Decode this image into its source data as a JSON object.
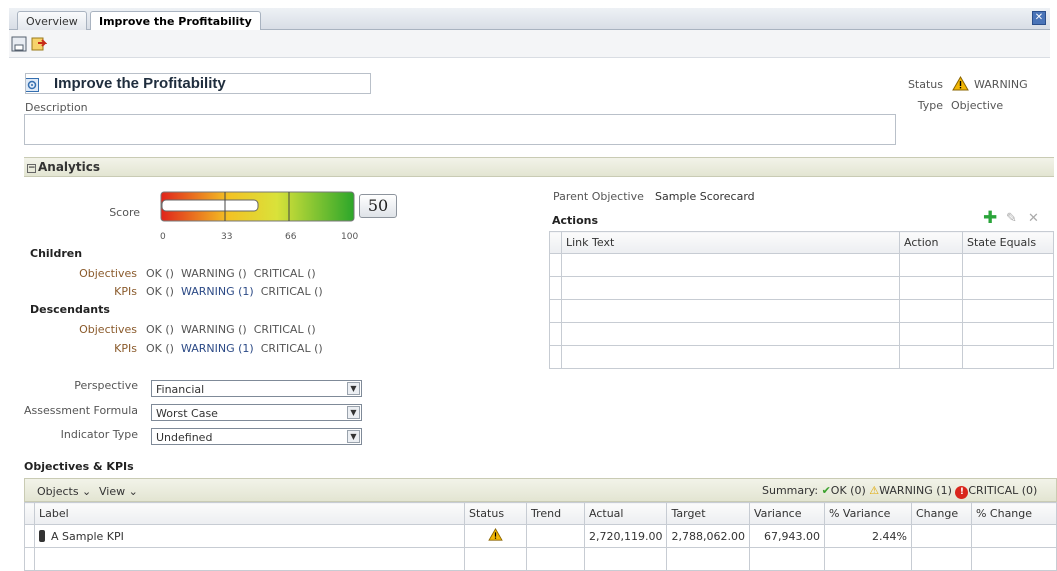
{
  "tabs": [
    {
      "label": "Overview",
      "active": false
    },
    {
      "label": "Improve the Profitability",
      "active": true
    }
  ],
  "close_label": "x",
  "header": {
    "title": "Improve the Profitability",
    "description_label": "Description",
    "status_label": "Status",
    "status_value": "WARNING",
    "type_label": "Type",
    "type_value": "Objective"
  },
  "analytics": {
    "section_title": "Analytics",
    "score_label": "Score",
    "score_value": "50",
    "gauge_ticks": [
      "0",
      "33",
      "66",
      "100"
    ],
    "gauge_level": 0.5,
    "children_title": "Children",
    "descendants_title": "Descendants",
    "objectives_label": "Objectives",
    "kpis_label": "KPIs",
    "status_ok": "OK ()",
    "status_warning_empty": "WARNING ()",
    "status_critical_empty": "CRITICAL ()",
    "status_warning_one": "WARNING (1)",
    "perspective_label": "Perspective",
    "perspective_value": "Financial",
    "assessment_label": "Assessment Formula",
    "assessment_value": "Worst Case",
    "indicator_label": "Indicator Type",
    "indicator_value": "Undefined"
  },
  "right_panel": {
    "parent_label": "Parent Objective",
    "parent_value": "Sample Scorecard",
    "actions_title": "Actions",
    "columns": [
      "Link Text",
      "Action",
      "State Equals"
    ]
  },
  "objectives_kpis": {
    "title": "Objectives & KPIs",
    "menu_objects": "Objects",
    "menu_view": "View",
    "summary_label": "Summary:",
    "summary_ok": "OK (0)",
    "summary_warning": "WARNING (1)",
    "summary_critical": "CRITICAL (0)",
    "columns": [
      "Label",
      "Status",
      "Trend",
      "Actual",
      "Target",
      "Variance",
      "% Variance",
      "Change",
      "% Change"
    ],
    "rows": [
      {
        "label": "A Sample KPI",
        "actual": "2,720,119.00",
        "target": "2,788,062.00",
        "variance": "67,943.00",
        "pct_variance": "2.44%"
      }
    ]
  },
  "colors": {
    "warning": "#f2b705",
    "ok": "#3aa12c",
    "critical": "#d9261c"
  }
}
